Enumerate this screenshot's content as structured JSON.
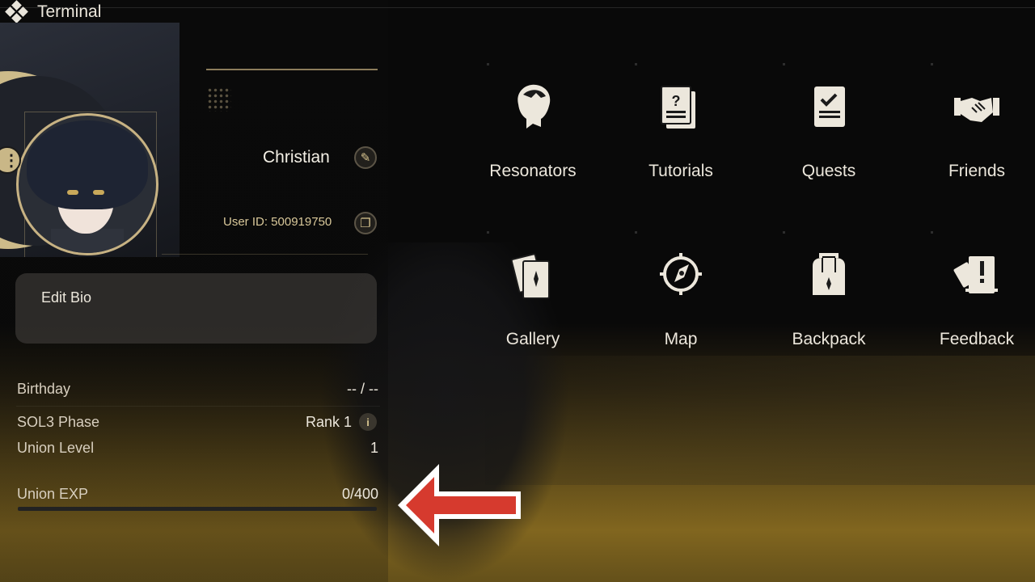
{
  "window": {
    "title": "Terminal"
  },
  "profile": {
    "name": "Christian",
    "user_id": "User ID: 500919750",
    "bio_placeholder": "Edit Bio"
  },
  "stats": {
    "birthday": {
      "label": "Birthday",
      "value": "-- / --"
    },
    "sol3_phase": {
      "label": "SOL3 Phase",
      "value": "Rank 1"
    },
    "union_level": {
      "label": "Union Level",
      "value": "1"
    },
    "union_exp": {
      "label": "Union EXP",
      "value": "0/400",
      "progress": 0
    }
  },
  "menu": {
    "resonators": "Resonators",
    "tutorials": "Tutorials",
    "quests": "Quests",
    "friends": "Friends",
    "gallery": "Gallery",
    "map": "Map",
    "backpack": "Backpack",
    "feedback": "Feedback"
  },
  "colors": {
    "accent": "#d8c590",
    "arrow": "#d63a2e",
    "text": "#ece7dc"
  },
  "icons": {
    "title": "diamond-cluster-icon",
    "edit": "pencil-icon",
    "copy": "copy-icon",
    "info": "info-icon",
    "more": "more-vertical-icon"
  }
}
